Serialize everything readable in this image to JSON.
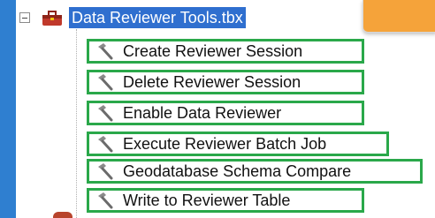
{
  "toolbox": {
    "name": "Data Reviewer Tools.tbx",
    "icon": "toolbox-icon",
    "expander_icon": "minus-box-icon",
    "selection_color": "#2f6fcf"
  },
  "tools": [
    {
      "label": "Create Reviewer Session",
      "icon": "hammer-icon"
    },
    {
      "label": "Delete Reviewer Session",
      "icon": "hammer-icon"
    },
    {
      "label": "Enable Data Reviewer",
      "icon": "hammer-icon"
    },
    {
      "label": "Execute Reviewer Batch Job",
      "icon": "hammer-icon"
    },
    {
      "label": "Geodatabase Schema Compare",
      "icon": "hammer-icon"
    },
    {
      "label": "Write to Reviewer Table",
      "icon": "hammer-icon"
    }
  ],
  "colors": {
    "background": "#2f7fd0",
    "highlight_box": "#2aa84a",
    "accent_tab": "#f5a33a"
  }
}
